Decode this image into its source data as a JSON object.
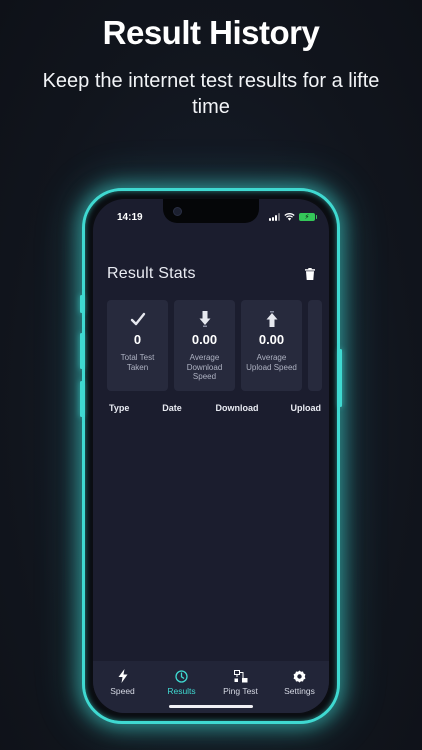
{
  "promo": {
    "headline": "Result History",
    "subline": "Keep the internet test results for a lifte time"
  },
  "status_bar": {
    "time": "14:19"
  },
  "screen": {
    "title": "Result Stats",
    "stats": [
      {
        "icon": "checkmark-icon",
        "value": "0",
        "label": "Total Test Taken"
      },
      {
        "icon": "download-arrow-icon",
        "value": "0.00",
        "label": "Average Download Speed"
      },
      {
        "icon": "upload-arrow-icon",
        "value": "0.00",
        "label": "Average Upload Speed"
      }
    ],
    "table_headers": [
      "Type",
      "Date",
      "Download",
      "Upload"
    ]
  },
  "tabbar": {
    "tabs": [
      {
        "label": "Speed",
        "icon": "lightning-icon"
      },
      {
        "label": "Results",
        "icon": "clock-icon"
      },
      {
        "label": "Ping Test",
        "icon": "network-icon"
      },
      {
        "label": "Settings",
        "icon": "gear-icon"
      }
    ],
    "active": "Results"
  },
  "colors": {
    "accent": "#3fd9d1",
    "screen_bg": "#1b1d2e",
    "card_bg": "#272a3d",
    "tabbar_bg": "#222538"
  }
}
